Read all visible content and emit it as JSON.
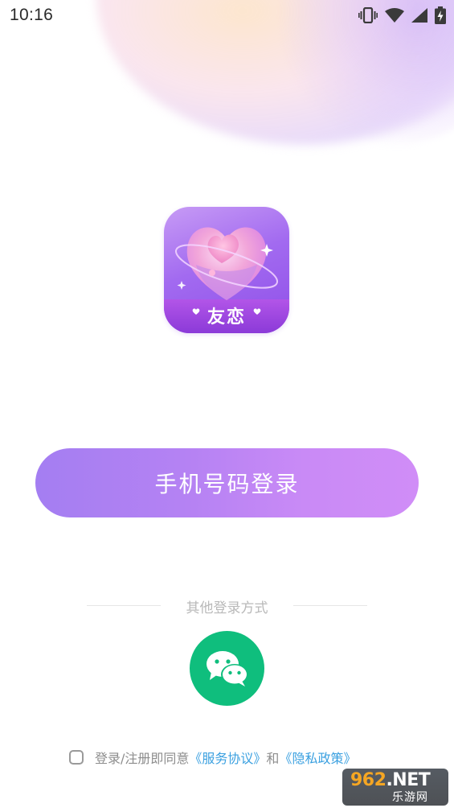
{
  "status_bar": {
    "time": "10:16",
    "icons": [
      "vibrate-icon",
      "wifi-icon",
      "signal-icon",
      "battery-charging-icon"
    ]
  },
  "app": {
    "logo_text": "友恋",
    "logo_icon": "heart-planet-icon"
  },
  "login": {
    "phone_button_label": "手机号码登录",
    "other_methods_label": "其他登录方式",
    "wechat_icon": "wechat-icon"
  },
  "agreement": {
    "prefix": "登录/注册即同意",
    "service_link": "《服务协议》",
    "conjunction": "和",
    "privacy_link": "《隐私政策》",
    "checked": false
  },
  "watermark": {
    "main": "962",
    "suffix": ".NET",
    "sub": "乐游网"
  },
  "colors": {
    "button_gradient_start": "#a47ef2",
    "button_gradient_end": "#d08df7",
    "wechat_green": "#0fbe7d",
    "link_blue": "#3aa0e0",
    "muted_text": "#8d8d8d",
    "divider": "#e6e6e6"
  }
}
